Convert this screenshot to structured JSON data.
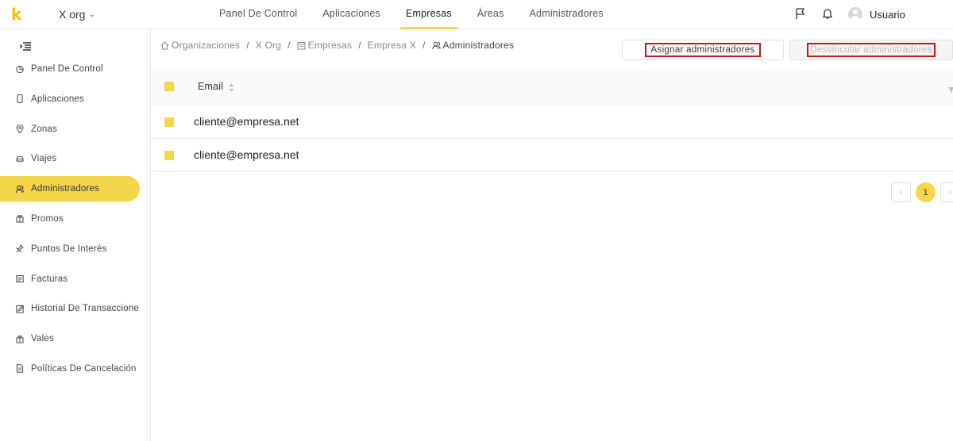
{
  "brand": {
    "logo_text": "k",
    "accent": "#f5d64a"
  },
  "org": {
    "name": "X org"
  },
  "nav": {
    "items": [
      {
        "label": "Panel De Control"
      },
      {
        "label": "Aplicaciones"
      },
      {
        "label": "Empresas",
        "active": true
      },
      {
        "label": "Áreas"
      },
      {
        "label": "Administradores"
      }
    ]
  },
  "user": {
    "name": "Usuario"
  },
  "sidebar": {
    "items": [
      {
        "label": "Panel De Control",
        "icon": "pie-chart-icon"
      },
      {
        "label": "Aplicaciones",
        "icon": "mobile-icon"
      },
      {
        "label": "Zonas",
        "icon": "location-icon"
      },
      {
        "label": "Viajes",
        "icon": "car-icon"
      },
      {
        "label": "Administradores",
        "icon": "users-icon",
        "active": true
      },
      {
        "label": "Promos",
        "icon": "gift-icon"
      },
      {
        "label": "Puntos De Interés",
        "icon": "pushpin-icon"
      },
      {
        "label": "Facturas",
        "icon": "invoice-icon"
      },
      {
        "label": "Historial De Transaccione",
        "icon": "edit-icon"
      },
      {
        "label": "Vales",
        "icon": "gift-icon"
      },
      {
        "label": "Políticas De Cancelación",
        "icon": "document-icon"
      }
    ]
  },
  "breadcrumb": {
    "items": [
      {
        "label": "Organizaciones",
        "icon": "home-icon"
      },
      {
        "label": "X Org"
      },
      {
        "label": "Empresas",
        "icon": "calendar-icon"
      },
      {
        "label": "Empresa X"
      },
      {
        "label": "Administradores",
        "icon": "users-icon"
      }
    ],
    "separator": "/"
  },
  "actions": {
    "assign_label": "Asignar administradores",
    "unlink_label": "Desvincular administradores"
  },
  "table": {
    "columns": [
      {
        "label": "Email"
      }
    ],
    "rows": [
      {
        "email": "cliente@empresa.net"
      },
      {
        "email": "cliente@empresa.net"
      }
    ]
  },
  "pagination": {
    "current": "1"
  }
}
